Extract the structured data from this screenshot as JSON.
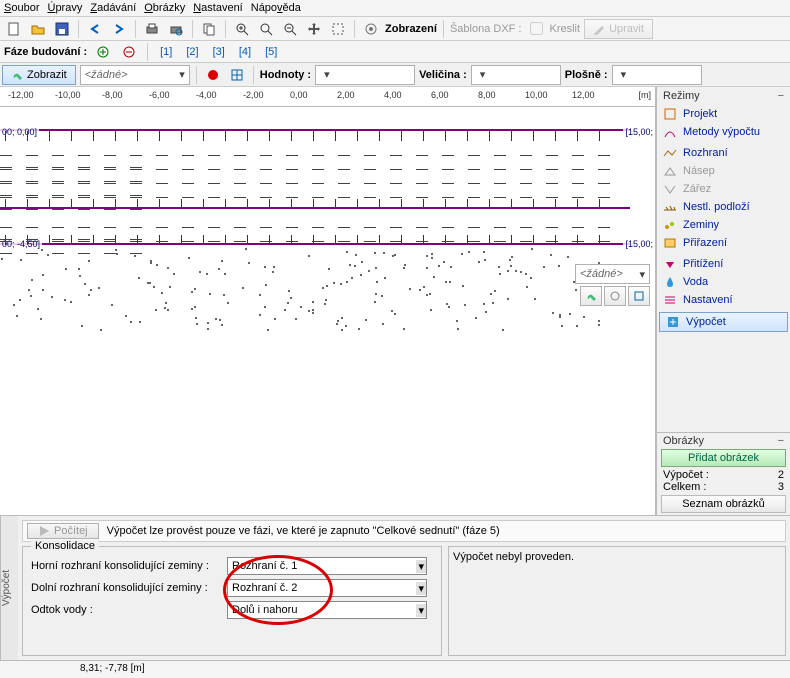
{
  "menu": [
    "Soubor",
    "Úpravy",
    "Zadávání",
    "Obrázky",
    "Nastavení",
    "Nápověda"
  ],
  "toolbar": {
    "display_label": "Zobrazení",
    "template_label": "Šablona DXF :",
    "draw_label": "Kreslit",
    "edit_label": "Upravit"
  },
  "phase": {
    "label": "Fáze budování :",
    "items": [
      "[1]",
      "[2]",
      "[3]",
      "[4]",
      "[5]"
    ]
  },
  "graph_toolbar": {
    "display": "Zobrazit",
    "none": "<žádné>",
    "values": "Hodnoty :",
    "magnitude": "Veličina :",
    "surface": "Plošně :"
  },
  "ruler": {
    "ticks": [
      "-12,00",
      "-10,00",
      "-8,00",
      "-6,00",
      "-4,00",
      "-2,00",
      "0,00",
      "2,00",
      "4,00",
      "6,00",
      "8,00",
      "10,00",
      "12,00"
    ],
    "unit": "[m]"
  },
  "coords": {
    "tl": "00; 0,00]",
    "tr": "[15,00;",
    "bl": "00; -4,50]",
    "br": "[15,00;"
  },
  "right_panel": {
    "title": "Režimy",
    "items": [
      {
        "icon": "project",
        "label": "Projekt"
      },
      {
        "icon": "methods",
        "label": "Metody výpočtu"
      },
      {
        "icon": "interfaces",
        "label": "Rozhraní"
      },
      {
        "icon": "embank",
        "label": "Násep",
        "disabled": true
      },
      {
        "icon": "cut",
        "label": "Zářez",
        "disabled": true
      },
      {
        "icon": "bedrock",
        "label": "Nestl. podloží"
      },
      {
        "icon": "soils",
        "label": "Zeminy"
      },
      {
        "icon": "assign",
        "label": "Přiřazení"
      },
      {
        "icon": "surcharge",
        "label": "Přitížení"
      },
      {
        "icon": "water",
        "label": "Voda"
      },
      {
        "icon": "settings",
        "label": "Nastavení"
      },
      {
        "icon": "calc",
        "label": "Výpočet",
        "active": true
      }
    ],
    "obr_title": "Obrázky",
    "add_pic": "Přidat obrázek",
    "stat1_l": "Výpočet :",
    "stat1_v": "2",
    "stat2_l": "Celkem :",
    "stat2_v": "3",
    "list_label": "Seznam obrázků"
  },
  "mini_combo": "<žádné>",
  "bottom": {
    "tab": "Výpočet",
    "calc_btn": "Počítej",
    "info": "Výpočet lze provést pouze ve fázi, ve které je zapnuto \"Celkové sednutí\"  (fáze 5)",
    "group": "Konsolidace",
    "row1_l": "Horní rozhraní konsolidující zeminy :",
    "row1_v": "Rozhraní č. 1",
    "row2_l": "Dolní rozhraní konsolidující zeminy :",
    "row2_v": "Rozhraní č. 2",
    "row3_l": "Odtok vody :",
    "row3_v": "Dolů i nahoru",
    "results": "Výpočet nebyl proveden."
  },
  "status": "8,31; -7,78 [m]"
}
